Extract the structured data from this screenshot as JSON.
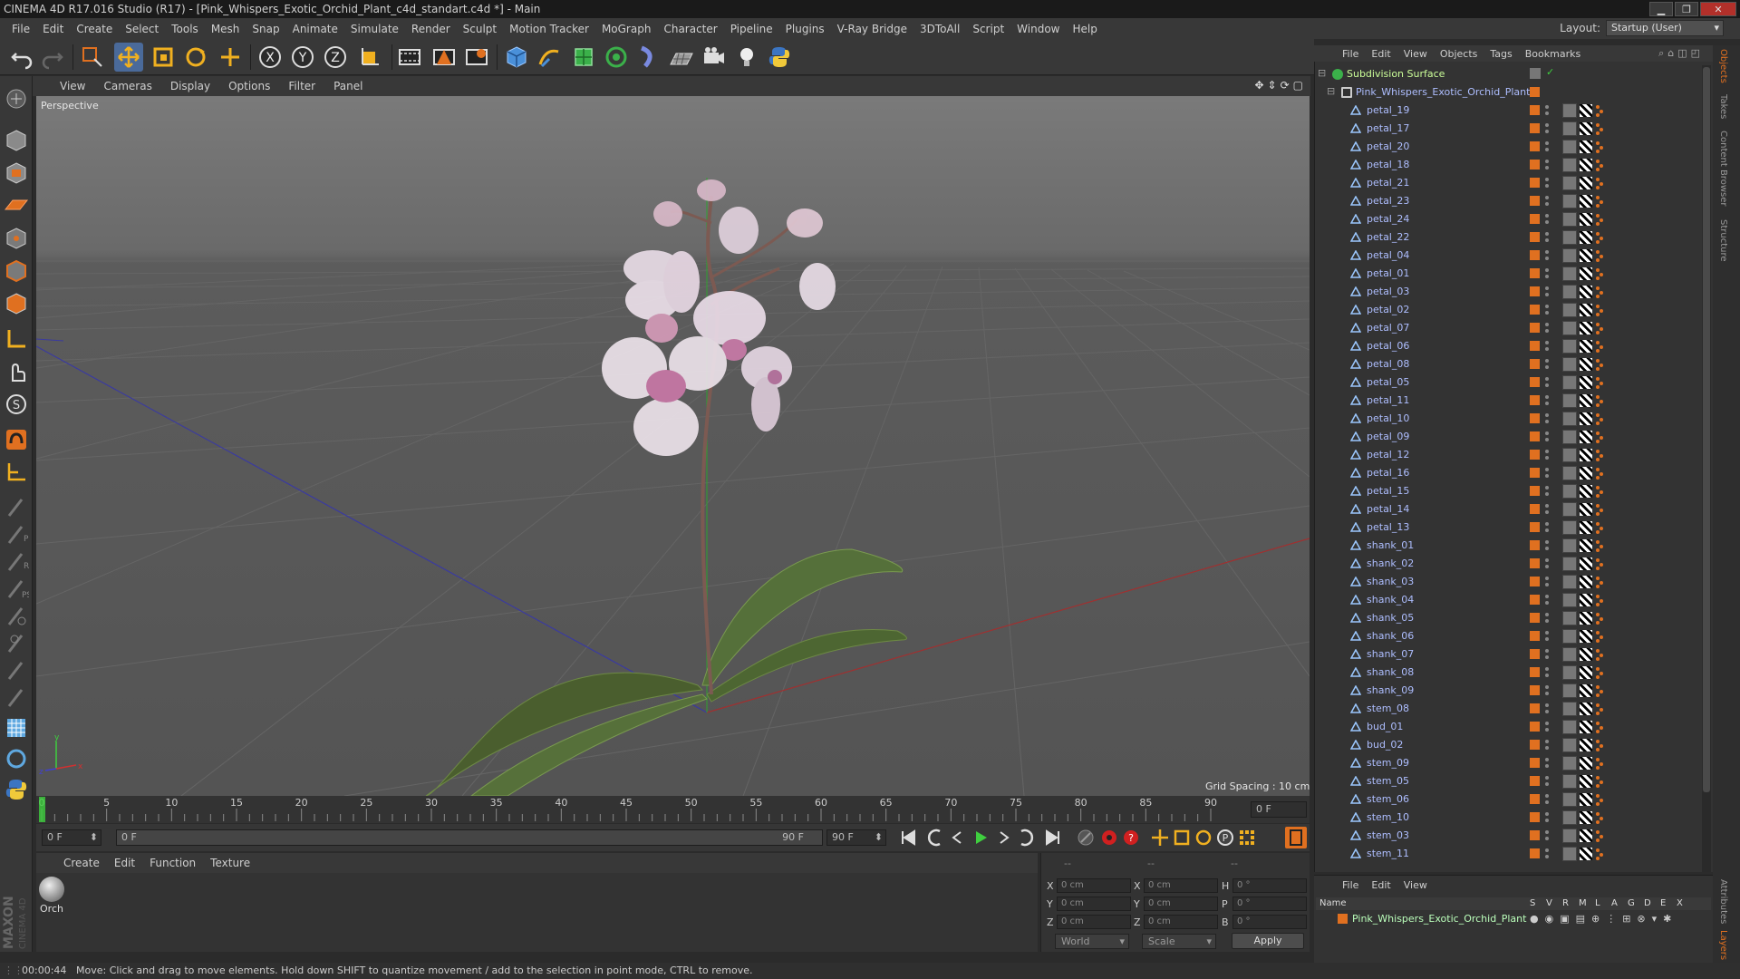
{
  "window": {
    "title": "CINEMA 4D R17.016 Studio (R17) - [Pink_Whispers_Exotic_Orchid_Plant_c4d_standart.c4d *] - Main",
    "btn_min": "▁",
    "btn_max": "❐",
    "btn_close": "✕"
  },
  "menubar": {
    "items": [
      "File",
      "Edit",
      "Create",
      "Select",
      "Tools",
      "Mesh",
      "Snap",
      "Animate",
      "Simulate",
      "Render",
      "Sculpt",
      "Motion Tracker",
      "MoGraph",
      "Character",
      "Pipeline",
      "Plugins",
      "V-Ray Bridge",
      "3DToAll",
      "Script",
      "Window",
      "Help"
    ],
    "layout_label": "Layout:",
    "layout_value": "Startup (User)"
  },
  "toolbar": {
    "icons": [
      "undo-icon",
      "redo-icon",
      "live-selection-icon",
      "move-icon",
      "scale-icon",
      "rotate-icon",
      "last-tool-icon",
      "x-axis-icon",
      "y-axis-icon",
      "z-axis-icon",
      "coordinate-system-icon",
      "render-view-icon",
      "render-picture-viewer-icon",
      "edit-render-settings-icon",
      "cube-icon",
      "pen-spline-icon",
      "subdivision-surface-icon",
      "cloner-icon",
      "deformer-icon",
      "floor-icon",
      "camera-icon",
      "light-icon",
      "python-icon"
    ],
    "axis_x": "X",
    "axis_y": "Y",
    "axis_z": "Z"
  },
  "viewport": {
    "menu": [
      "View",
      "Cameras",
      "Display",
      "Options",
      "Filter",
      "Panel"
    ],
    "label": "Perspective",
    "grid_spacing": "Grid Spacing : 10 cm",
    "axis_x": "x",
    "axis_y": "y",
    "axis_z": "z"
  },
  "timeline": {
    "ticks": [
      "0",
      "5",
      "10",
      "15",
      "20",
      "25",
      "30",
      "35",
      "40",
      "45",
      "50",
      "55",
      "60",
      "65",
      "70",
      "75",
      "80",
      "85",
      "90"
    ],
    "current_frame_field": "0 F",
    "start_field": "0 F",
    "range_start": "0 F",
    "range_end": "90 F",
    "end_field": "90 F",
    "current_frame": 0,
    "max_frame": 90
  },
  "material_manager": {
    "menu": [
      "Create",
      "Edit",
      "Function",
      "Texture"
    ],
    "material_name": "Orch"
  },
  "coordinates": {
    "header_dashes": [
      "--",
      "--",
      "--"
    ],
    "rows": [
      {
        "axis": "X",
        "pos": "0 cm",
        "size_axis": "X",
        "size": "0 cm",
        "rot_axis": "H",
        "rot": "0 °"
      },
      {
        "axis": "Y",
        "pos": "0 cm",
        "size_axis": "Y",
        "size": "0 cm",
        "rot_axis": "P",
        "rot": "0 °"
      },
      {
        "axis": "Z",
        "pos": "0 cm",
        "size_axis": "Z",
        "size": "0 cm",
        "rot_axis": "B",
        "rot": "0 °"
      }
    ],
    "mode": "World",
    "size_mode": "Scale",
    "apply": "Apply"
  },
  "object_manager": {
    "menu": [
      "File",
      "Edit",
      "View",
      "Objects",
      "Tags",
      "Bookmarks"
    ],
    "root": "Subdivision Surface",
    "group": "Pink_Whispers_Exotic_Orchid_Plant",
    "objects": [
      "petal_19",
      "petal_17",
      "petal_20",
      "petal_18",
      "petal_21",
      "petal_23",
      "petal_24",
      "petal_22",
      "petal_04",
      "petal_01",
      "petal_03",
      "petal_02",
      "petal_07",
      "petal_06",
      "petal_08",
      "petal_05",
      "petal_11",
      "petal_10",
      "petal_09",
      "petal_12",
      "petal_16",
      "petal_15",
      "petal_14",
      "petal_13",
      "shank_01",
      "shank_02",
      "shank_03",
      "shank_04",
      "shank_05",
      "shank_06",
      "shank_07",
      "shank_08",
      "shank_09",
      "stem_08",
      "bud_01",
      "bud_02",
      "stem_09",
      "stem_05",
      "stem_06",
      "stem_10",
      "stem_03",
      "stem_11"
    ]
  },
  "right_tabs": [
    "Objects",
    "Takes",
    "Content Browser",
    "Structure",
    "Attributes",
    "Layers"
  ],
  "layer_manager": {
    "menu": [
      "File",
      "Edit",
      "View"
    ],
    "columns": [
      "Name",
      "S",
      "V",
      "R",
      "M",
      "L",
      "A",
      "G",
      "D",
      "E",
      "X"
    ],
    "layer_name": "Pink_Whispers_Exotic_Orchid_Plant",
    "layer_color": "#e07020"
  },
  "status": {
    "time": "00:00:44",
    "message": "Move: Click and drag to move elements. Hold down SHIFT to quantize movement / add to the selection in point mode, CTRL to remove."
  },
  "colors": {
    "accent_orange": "#e07020",
    "object_name": "#aebeff",
    "play_green": "#3fcf3f",
    "record_red": "#d02020"
  }
}
